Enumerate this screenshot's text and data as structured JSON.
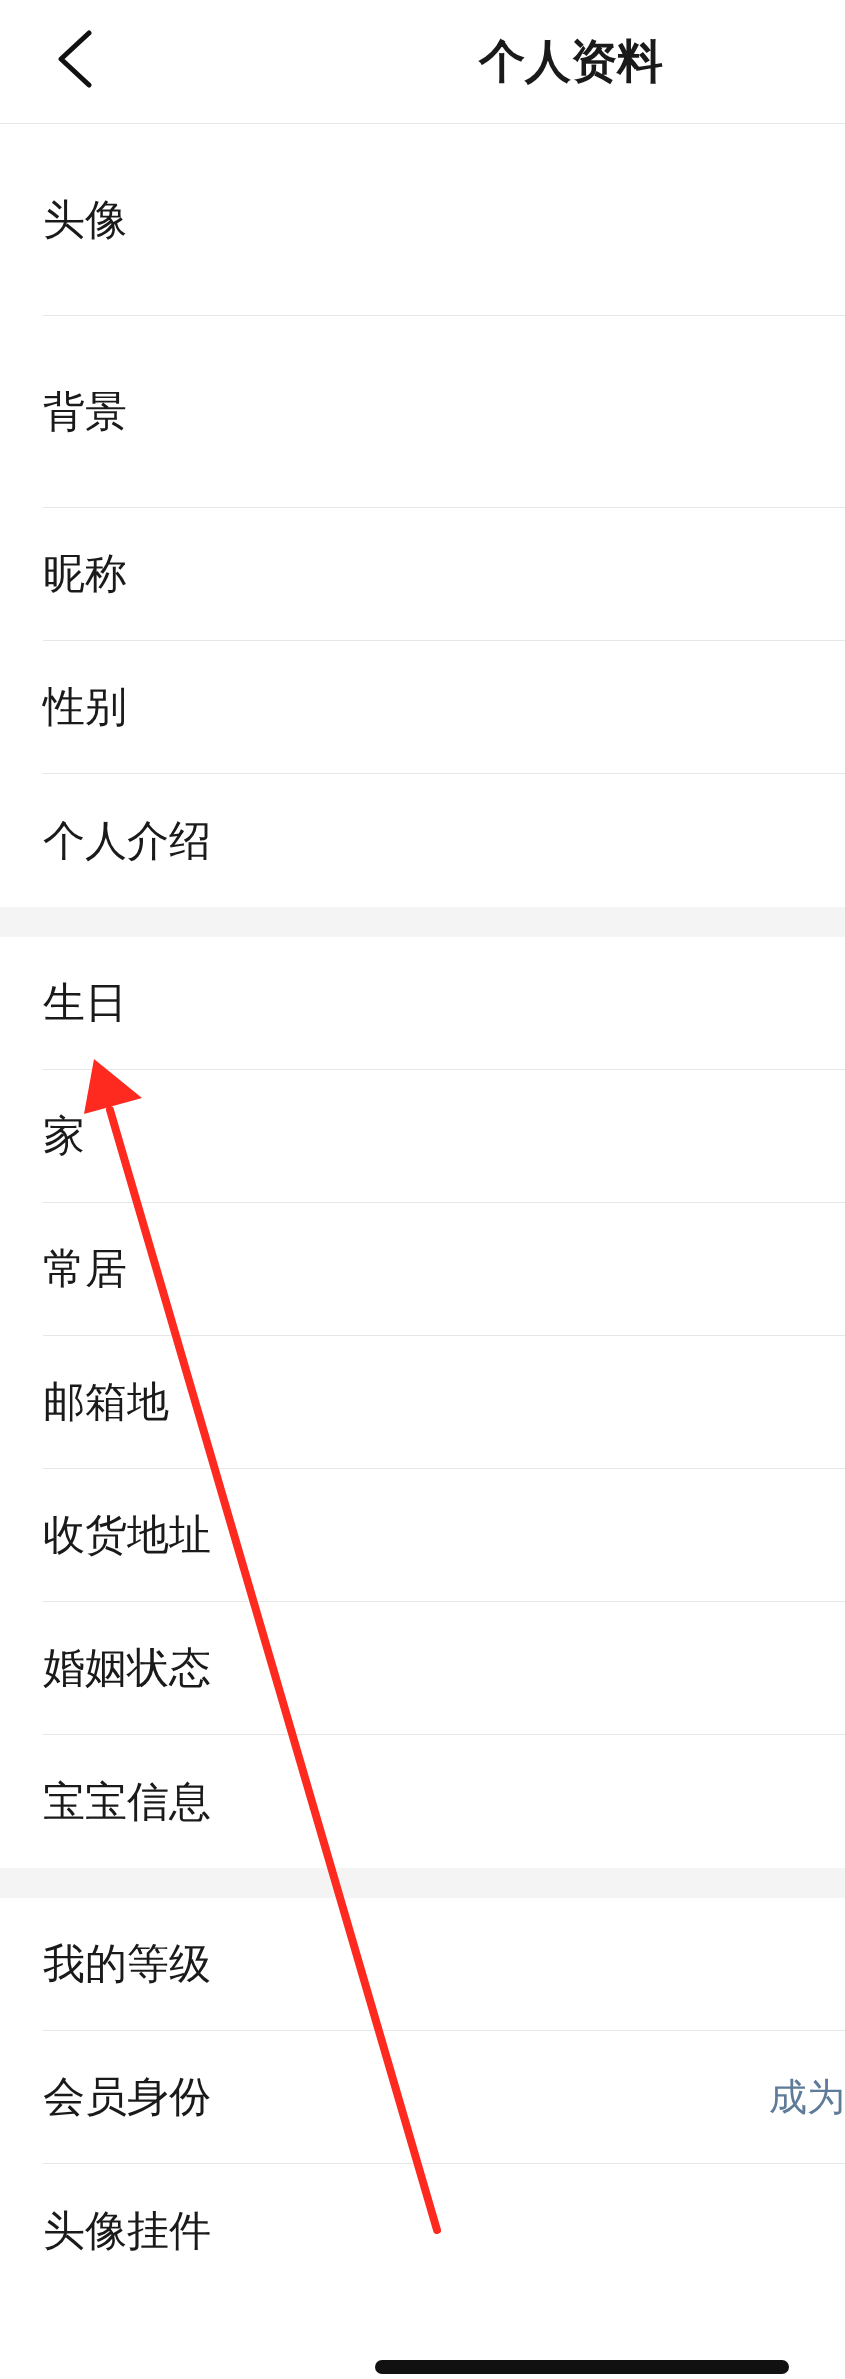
{
  "header": {
    "title": "个人资料"
  },
  "sections": [
    {
      "items": [
        {
          "kind": "tall",
          "label": "头像"
        },
        {
          "kind": "tall",
          "label": "背景"
        },
        {
          "kind": "normal",
          "label": "昵称"
        },
        {
          "kind": "normal",
          "label": "性别"
        },
        {
          "kind": "normal",
          "label": "个人介绍"
        }
      ]
    },
    {
      "items": [
        {
          "kind": "normal",
          "label": "生日"
        },
        {
          "kind": "normal",
          "label": "家"
        },
        {
          "kind": "normal",
          "label": "常居"
        },
        {
          "kind": "normal",
          "label": "邮箱地"
        },
        {
          "kind": "normal",
          "label": "收货地址"
        },
        {
          "kind": "normal",
          "label": "婚姻状态"
        },
        {
          "kind": "normal",
          "label": "宝宝信息"
        }
      ]
    },
    {
      "items": [
        {
          "kind": "normal",
          "label": "我的等级"
        },
        {
          "kind": "normal",
          "label": "会员身份",
          "value": "成为"
        },
        {
          "kind": "normal",
          "label": "头像挂件"
        }
      ]
    }
  ]
}
